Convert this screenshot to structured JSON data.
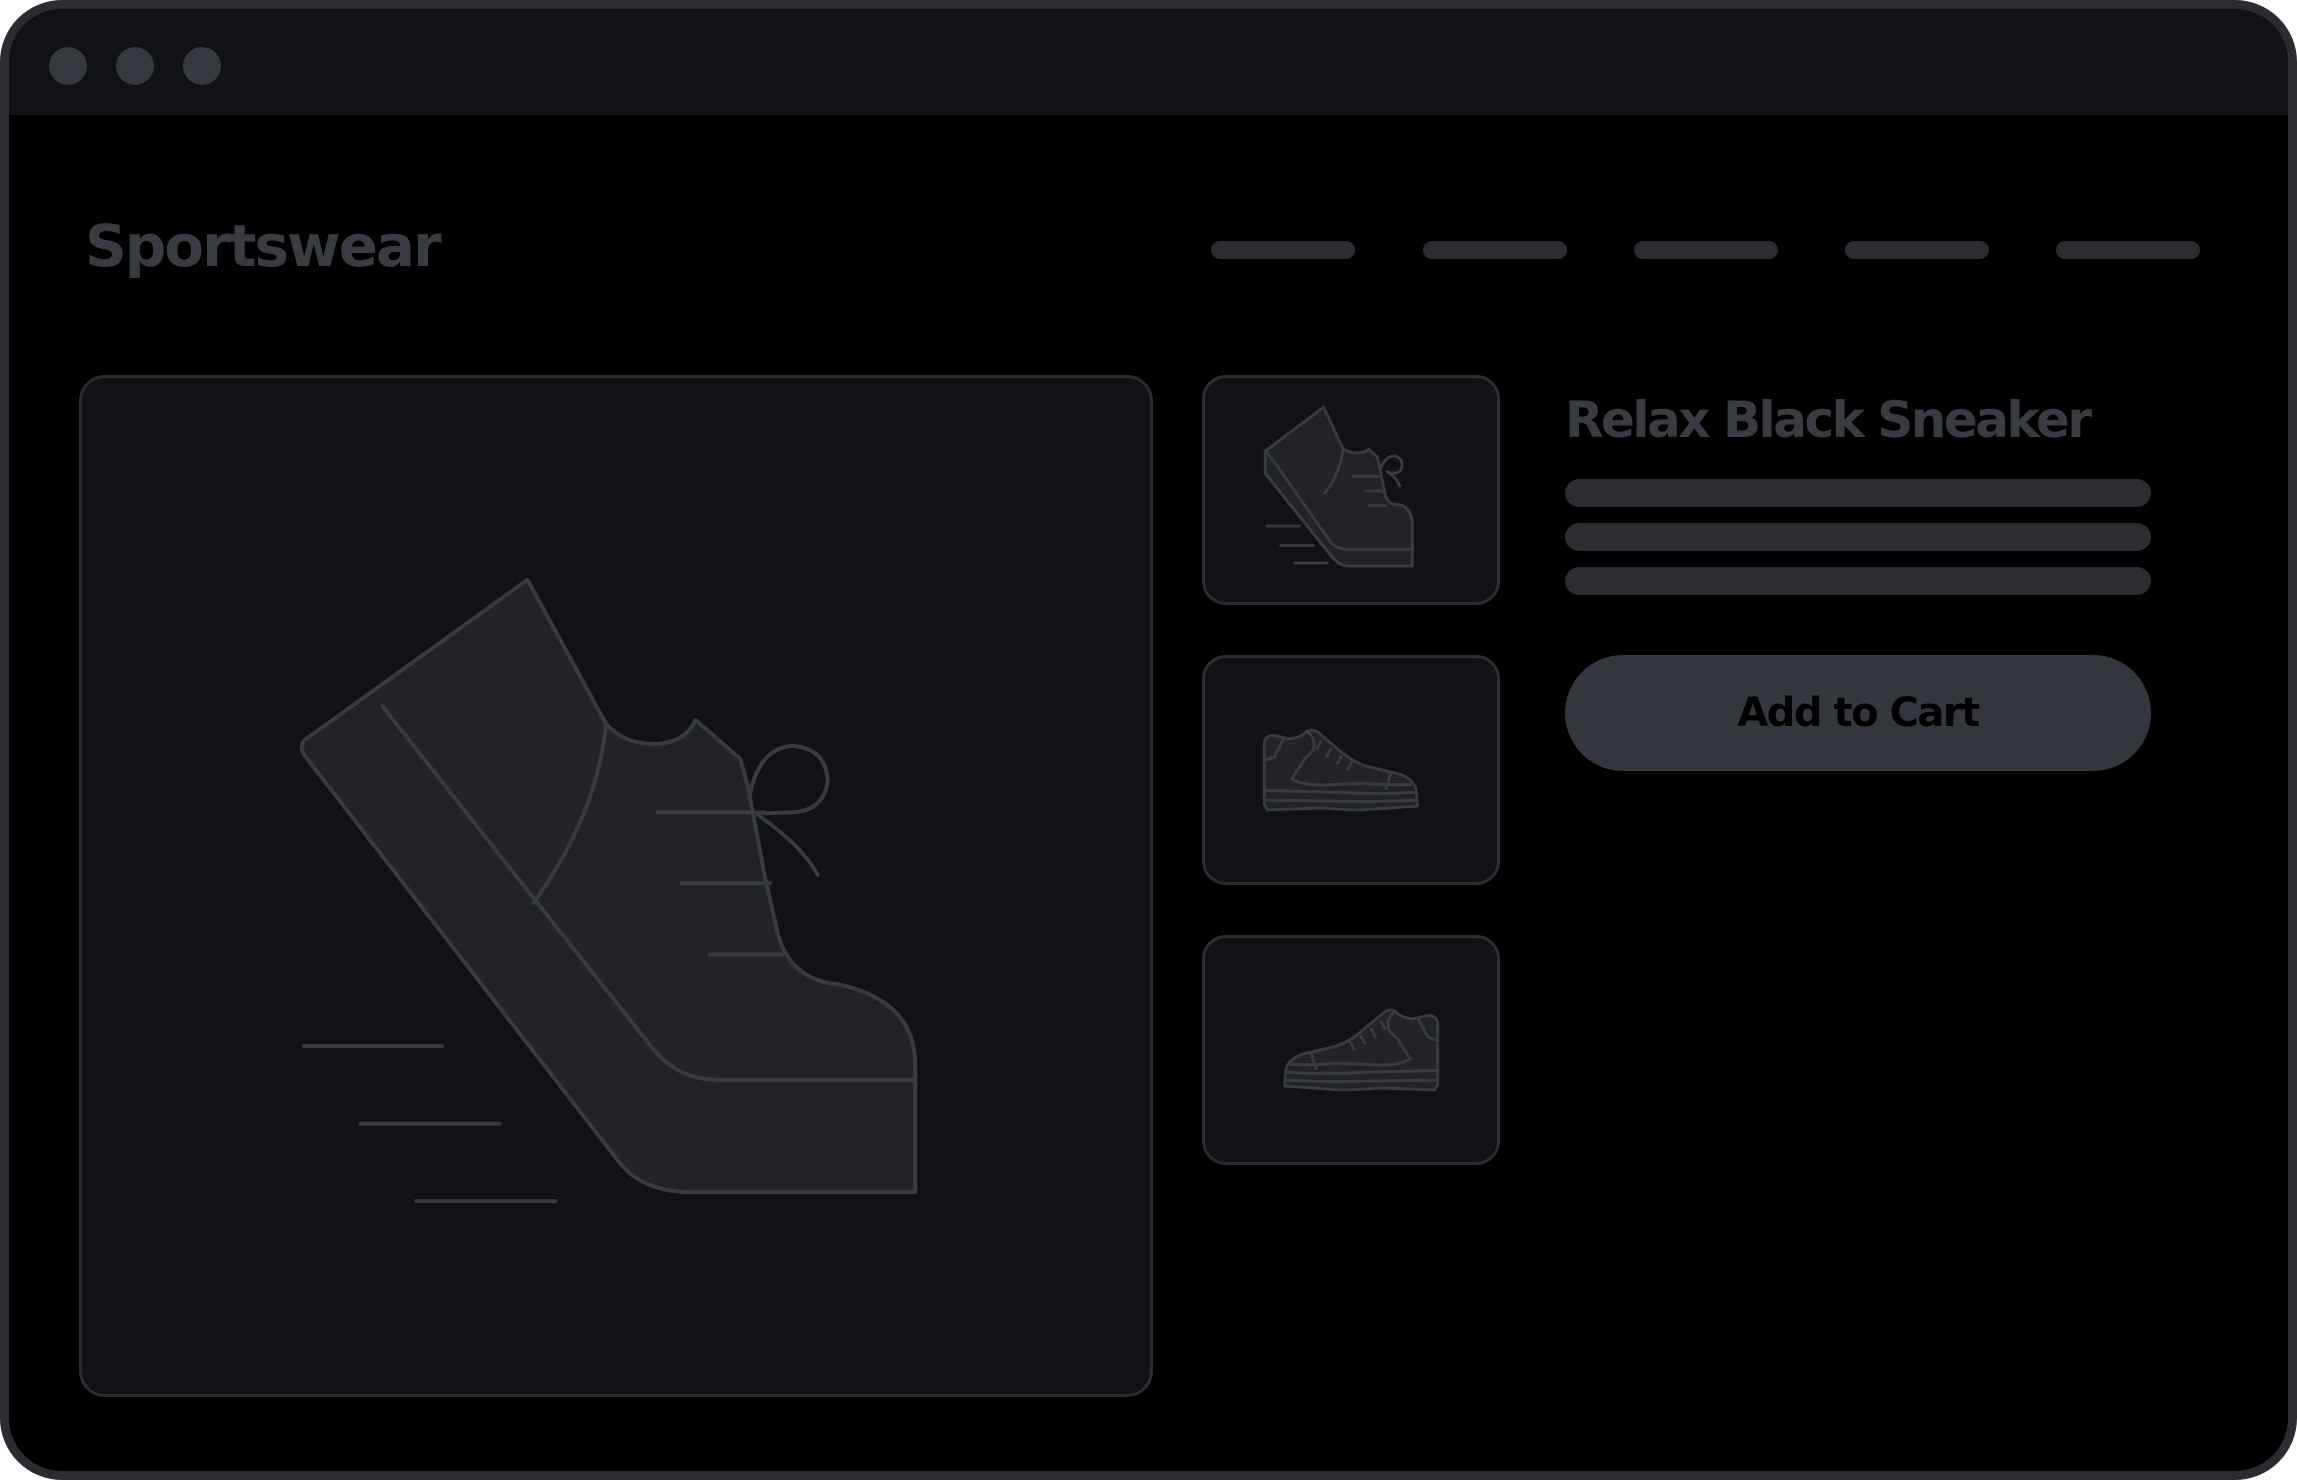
{
  "window": {
    "controls": [
      "close",
      "minimize",
      "maximize"
    ]
  },
  "header": {
    "brand": "Sportswear",
    "nav_count": 5
  },
  "gallery": {
    "main_image_icon": "running-sneaker-icon",
    "thumbnails": [
      {
        "icon": "running-sneaker-icon"
      },
      {
        "icon": "sneaker-side-right-icon"
      },
      {
        "icon": "sneaker-side-left-icon"
      }
    ]
  },
  "product": {
    "title": "Relax Black Sneaker",
    "description_line_count": 3,
    "add_to_cart_label": "Add to Cart"
  },
  "colors": {
    "window_bg": "#000000",
    "titlebar": "#111215",
    "frame": "#2a2c32",
    "panel": "#111215",
    "muted_text": "#3a3c43",
    "button": "#35373e",
    "shoe_fill": "#222328",
    "shoe_stroke": "#393b42"
  }
}
